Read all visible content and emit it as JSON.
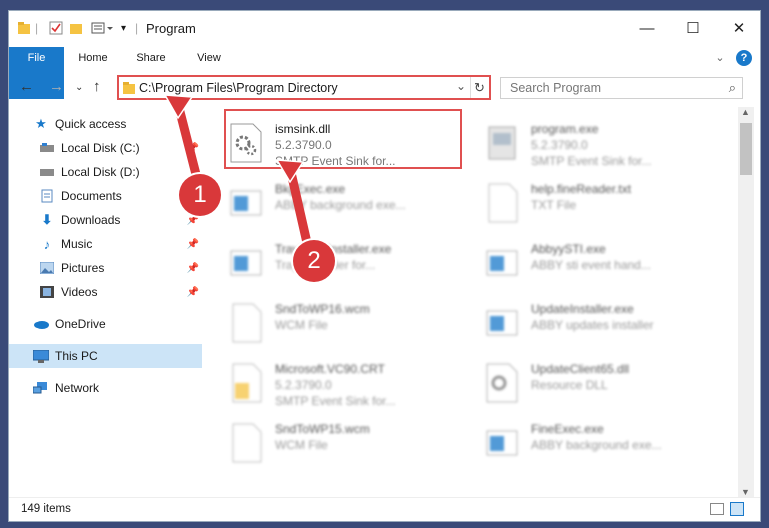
{
  "window": {
    "title": "Program",
    "minimize": "—",
    "maximize": "☐",
    "close": "✕"
  },
  "ribbon": {
    "tabs": [
      "File",
      "Home",
      "Share",
      "View"
    ],
    "help": "?"
  },
  "address": {
    "path": "C:\\Program Files\\Program Directory",
    "search_placeholder": "Search Program"
  },
  "nav": {
    "items": [
      {
        "label": "Quick access",
        "icon": "star-icon",
        "pinned": false
      },
      {
        "label": "Local Disk (C:)",
        "icon": "drive-icon",
        "pinned": true
      },
      {
        "label": "Local Disk (D:)",
        "icon": "drive-icon",
        "pinned": false
      },
      {
        "label": "Documents",
        "icon": "documents-icon",
        "pinned": true
      },
      {
        "label": "Downloads",
        "icon": "download-icon",
        "pinned": true
      },
      {
        "label": "Music",
        "icon": "music-icon",
        "pinned": true
      },
      {
        "label": "Pictures",
        "icon": "pictures-icon",
        "pinned": true
      },
      {
        "label": "Videos",
        "icon": "videos-icon",
        "pinned": true
      },
      {
        "label": "OneDrive",
        "icon": "cloud-icon",
        "pinned": false
      },
      {
        "label": "This PC",
        "icon": "pc-icon",
        "pinned": false
      },
      {
        "label": "Network",
        "icon": "network-icon",
        "pinned": false
      }
    ]
  },
  "files": [
    {
      "name": "ismsink.dll",
      "line2": "5.2.3790.0",
      "line3": "SMTP Event Sink for...",
      "type": "dll"
    },
    {
      "name": "program.exe",
      "line2": "5.2.3790.0",
      "line3": "SMTP Event Sink for...",
      "type": "exe"
    },
    {
      "name": "BkgExec.exe",
      "line2": "ABBY background exe...",
      "line3": "",
      "type": "app"
    },
    {
      "name": "help.fineReader.txt",
      "line2": "TXT File",
      "line3": "",
      "type": "txt"
    },
    {
      "name": "TrayIconsInstaller.exe",
      "line2": "Tray ... loader for...",
      "line3": "",
      "type": "app"
    },
    {
      "name": "AbbyySTI.exe",
      "line2": "ABBY sti event hand...",
      "line3": "",
      "type": "app"
    },
    {
      "name": "SndToWP16.wcm",
      "line2": "WCM File",
      "line3": "",
      "type": "txt"
    },
    {
      "name": "UpdateInstaller.exe",
      "line2": "ABBY updates installer",
      "line3": "",
      "type": "app"
    },
    {
      "name": "Microsoft.VC90.CRT",
      "line2": "5.2.3790.0",
      "line3": "SMTP Event Sink for...",
      "type": "folder"
    },
    {
      "name": "UpdateClient65.dll",
      "line2": "Resource DLL",
      "line3": "",
      "type": "dll"
    },
    {
      "name": "SndToWP15.wcm",
      "line2": "WCM File",
      "line3": "",
      "type": "txt"
    },
    {
      "name": "FineExec.exe",
      "line2": "ABBY background exe...",
      "line3": "",
      "type": "app"
    }
  ],
  "status": {
    "count": "149 items"
  },
  "callouts": [
    "1",
    "2"
  ],
  "colors": {
    "accent": "#1979ca",
    "highlight": "#e05050",
    "callout": "#d9383a",
    "selected": "#cce4f7"
  }
}
